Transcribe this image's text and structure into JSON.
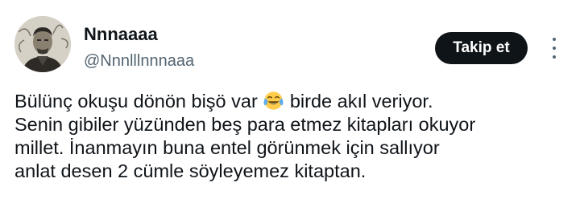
{
  "author": {
    "display_name": "Nnnaaaa",
    "handle": "@Nnnlllnnnaaa"
  },
  "actions": {
    "follow_label": "Takip et"
  },
  "icons": {
    "more": "more-horizontal-icon",
    "emoji": "face-with-tears-of-joy-emoji"
  },
  "tweet": {
    "line1_before_emoji": "Bülünç okuşu dönön bişö var ",
    "line1_after_emoji": " birde akıl veriyor.",
    "line2": "Senin gibiler yüzünden beş para etmez kitapları okuyor",
    "line3": "millet. İnanmayın buna entel görünmek için sallıyor",
    "line4": "anlat desen 2 cümle söyleyemez kitaptan."
  },
  "colors": {
    "text": "#0f1419",
    "secondary": "#536471",
    "button_bg": "#0f1419",
    "button_text": "#ffffff"
  }
}
